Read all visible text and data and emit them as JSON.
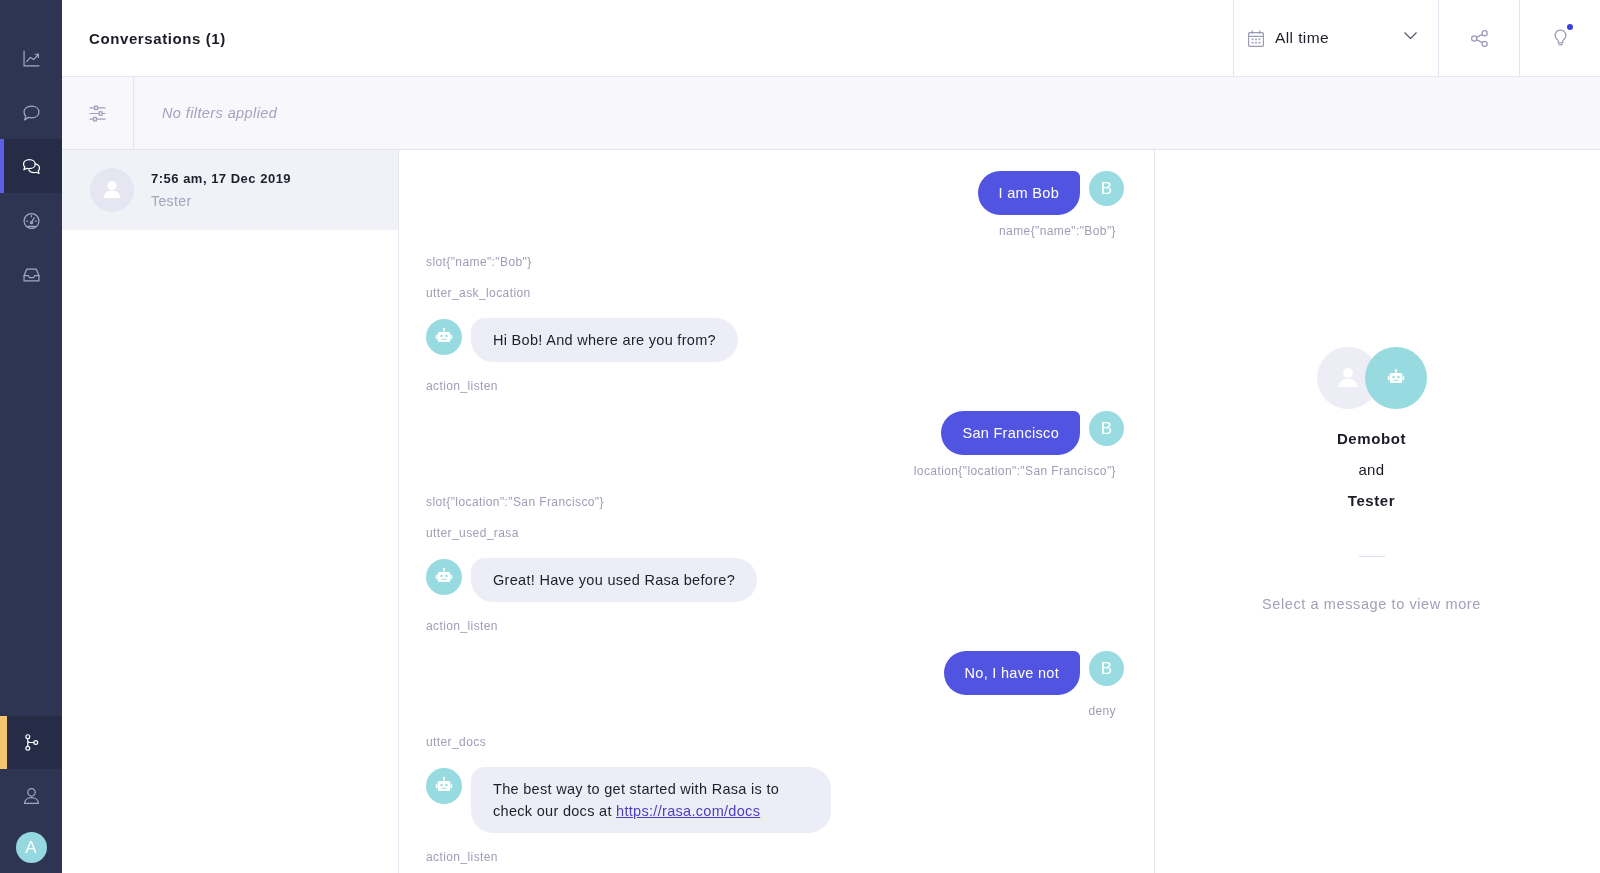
{
  "sidebar": {
    "items": [
      {
        "selected": false
      },
      {
        "selected": false
      },
      {
        "selected": true
      },
      {
        "selected": false
      },
      {
        "selected": false
      }
    ],
    "bottom_items": [
      {
        "selected": true
      },
      {
        "selected": false
      }
    ],
    "user_avatar": "A"
  },
  "header": {
    "title": "Conversations (1)",
    "date_filter": "All time",
    "notification": true
  },
  "filter_bar": {
    "status": "No filters applied"
  },
  "conversations": [
    {
      "time": "7:56 am, 17 Dec 2019",
      "name": "Tester",
      "selected": true
    }
  ],
  "chat": {
    "events": [
      {
        "kind": "user",
        "text": "I am Bob",
        "avatar": "B",
        "intent": "name{\"name\":\"Bob\"}"
      },
      {
        "kind": "event",
        "text": "slot{\"name\":\"Bob\"}"
      },
      {
        "kind": "event",
        "text": "utter_ask_location"
      },
      {
        "kind": "bot",
        "text": "Hi Bob! And where are you from?"
      },
      {
        "kind": "event",
        "text": "action_listen"
      },
      {
        "kind": "user",
        "text": "San Francisco",
        "avatar": "B",
        "intent": "location{\"location\":\"San Francisco\"}"
      },
      {
        "kind": "event",
        "text": "slot{\"location\":\"San Francisco\"}"
      },
      {
        "kind": "event",
        "text": "utter_used_rasa"
      },
      {
        "kind": "bot",
        "text": "Great! Have you used Rasa before?"
      },
      {
        "kind": "event",
        "text": "action_listen"
      },
      {
        "kind": "user",
        "text": "No, I have not",
        "avatar": "B",
        "intent": "deny"
      },
      {
        "kind": "event",
        "text": "utter_docs"
      },
      {
        "kind": "bot",
        "text": "The best way to get started with Rasa is to check our docs at",
        "link": "https://rasa.com/docs"
      },
      {
        "kind": "event",
        "text": "action_listen"
      }
    ]
  },
  "details": {
    "bot_name": "Demobot",
    "joiner": "and",
    "user_name": "Tester",
    "hint": "Select a message to view more"
  }
}
